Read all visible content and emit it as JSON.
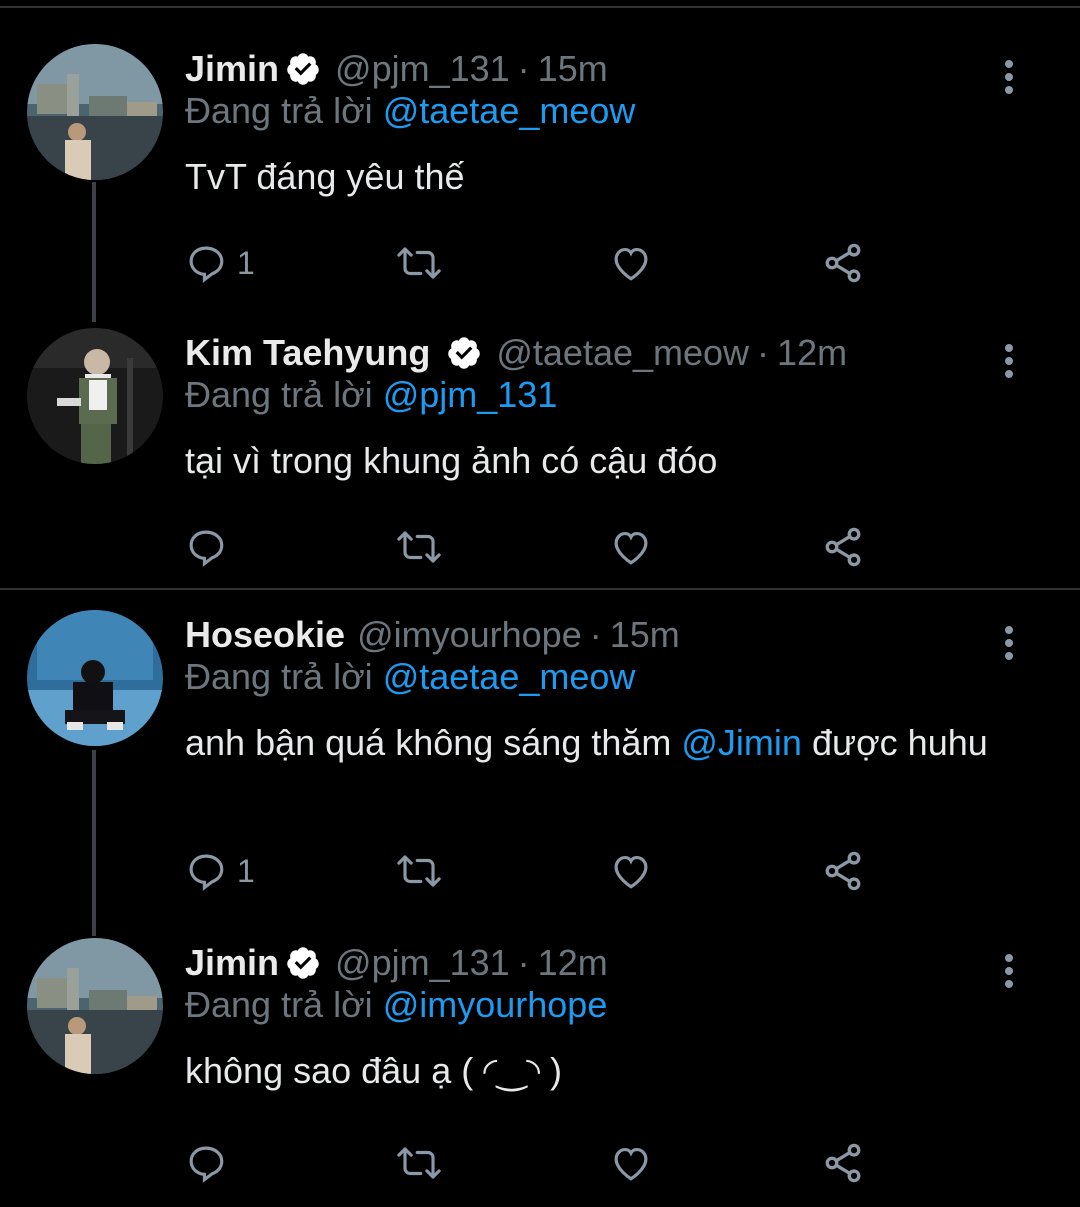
{
  "reply_prefix": "Đang trả lời",
  "tweets": [
    {
      "name": "Jimin",
      "verified": true,
      "handle": "@pjm_131",
      "separator": "·",
      "time": "15m",
      "reply_to": "@taetae_meow",
      "text": "TvT đáng yêu thế",
      "reply_count": "1",
      "avatar": "rooftop-photo"
    },
    {
      "name": "Kim Taehyung",
      "verified": true,
      "handle": "@taetae_meow",
      "separator": "·",
      "time": "12m",
      "reply_to": "@pjm_131",
      "text": "tại vì trong khung ảnh có cậu đóo",
      "reply_count": "",
      "avatar": "suit-photo"
    },
    {
      "name": "Hoseokie",
      "verified": false,
      "handle": "@imyourhope",
      "separator": "·",
      "time": "15m",
      "reply_to": "@taetae_meow",
      "text_before": "anh bận quá không sáng thăm ",
      "text_mention": "@Jimin",
      "text_after": " được huhu",
      "reply_count": "1",
      "avatar": "blue-chair-photo"
    },
    {
      "name": "Jimin",
      "verified": true,
      "handle": "@pjm_131",
      "separator": "·",
      "time": "12m",
      "reply_to": "@imyourhope",
      "text": "không sao đâu ạ ( ◜‿◝ )",
      "reply_count": "",
      "avatar": "rooftop-photo"
    }
  ],
  "icons": [
    "reply-icon",
    "retweet-icon",
    "like-icon",
    "share-icon",
    "more-icon",
    "verified-icon"
  ],
  "colors": {
    "background": "#000000",
    "accent": "#1d9bf0",
    "muted": "#6e767d"
  }
}
